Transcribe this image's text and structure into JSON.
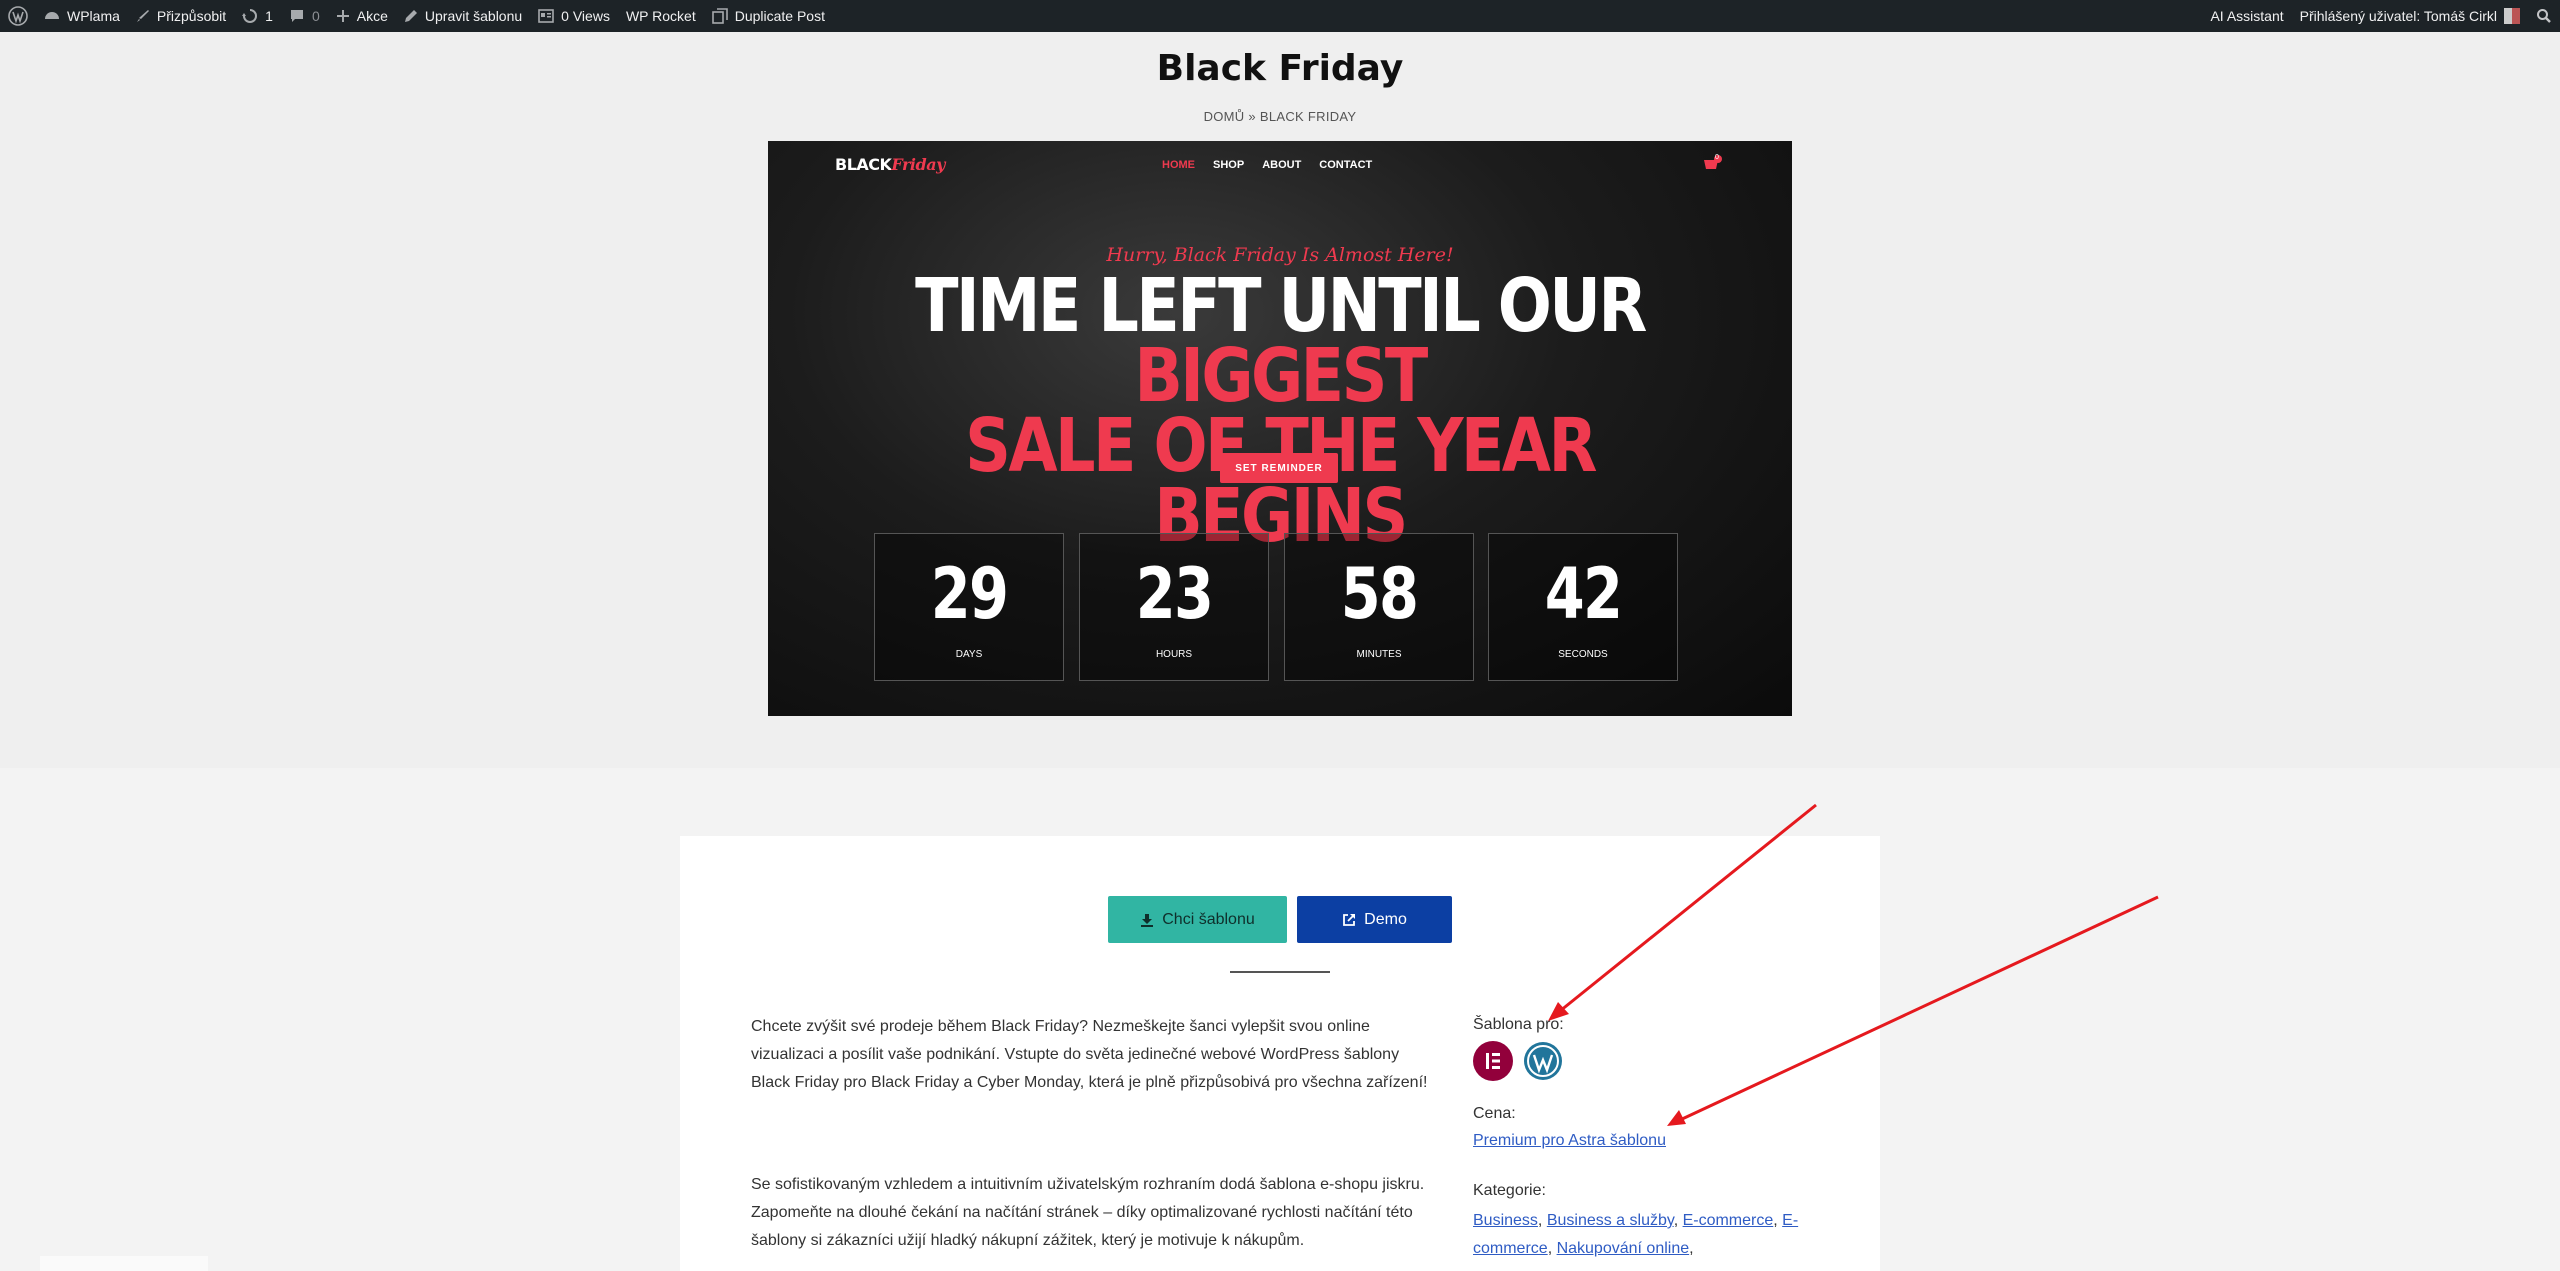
{
  "adminbar": {
    "site_name": "WPlama",
    "customize": "Přizpůsobit",
    "updates_count": "1",
    "comments_count": "0",
    "new_label": "Akce",
    "edit_template": "Upravit šablonu",
    "views": "0 Views",
    "wp_rocket": "WP Rocket",
    "duplicate_post": "Duplicate Post",
    "ai_assistant": "AI Assistant",
    "logged_user": "Přihlášený uživatel: Tomáš Cirkl"
  },
  "page": {
    "title": "Black Friday",
    "breadcrumb": "DOMŮ » BLACK FRIDAY"
  },
  "hero": {
    "logo_bold": "BLACK",
    "logo_script": "Friday",
    "menu": [
      "HOME",
      "SHOP",
      "ABOUT",
      "CONTACT"
    ],
    "active_menu": "HOME",
    "cart_count": "0",
    "tagline": "Hurry, Black Friday Is Almost Here!",
    "headline_white": "TIME LEFT UNTIL OUR",
    "headline_red_1": "BIGGEST",
    "headline_red_2": "SALE OF THE YEAR BEGINS",
    "reminder_button": "SET REMINDER",
    "countdown": [
      {
        "value": "29",
        "label": "DAYS"
      },
      {
        "value": "23",
        "label": "HOURS"
      },
      {
        "value": "58",
        "label": "MINUTES"
      },
      {
        "value": "42",
        "label": "SECONDS"
      }
    ],
    "accent_color": "#ef3a4f"
  },
  "actions": {
    "primary_label": "Chci šablonu",
    "demo_label": "Demo",
    "primary_color": "#31b5a3",
    "demo_color": "#0c3fa3"
  },
  "description": {
    "paragraph1": "Chcete zvýšit své prodeje během Black Friday? Nezmeškejte šanci vylepšit svou online vizualizaci a posílit vaše podnikání. Vstupte do světa jedinečné webové WordPress šablony Black Friday pro Black Friday a Cyber Monday, která je plně přizpůsobivá pro všechna zařízení!",
    "paragraph2": "Se sofistikovaným vzhledem a intuitivním uživatelským rozhraním dodá šablona e-shopu jiskru. Zapomeňte na dlouhé čekání na načítání stránek – díky optimalizované rychlosti načítání této šablony si zákazníci užijí hladký nákupní zážitek, který je motivuje k nákupům."
  },
  "sidebar": {
    "template_for_label": "Šablona pro:",
    "platform_icons": [
      "elementor-icon",
      "wordpress-icon"
    ],
    "price_label": "Cena:",
    "price_link": "Premium pro Astra šablonu",
    "categories_label": "Kategorie:",
    "categories": [
      "Business",
      "Business a služby",
      "E-commerce",
      "E-commerce",
      "Nakupování online"
    ]
  }
}
